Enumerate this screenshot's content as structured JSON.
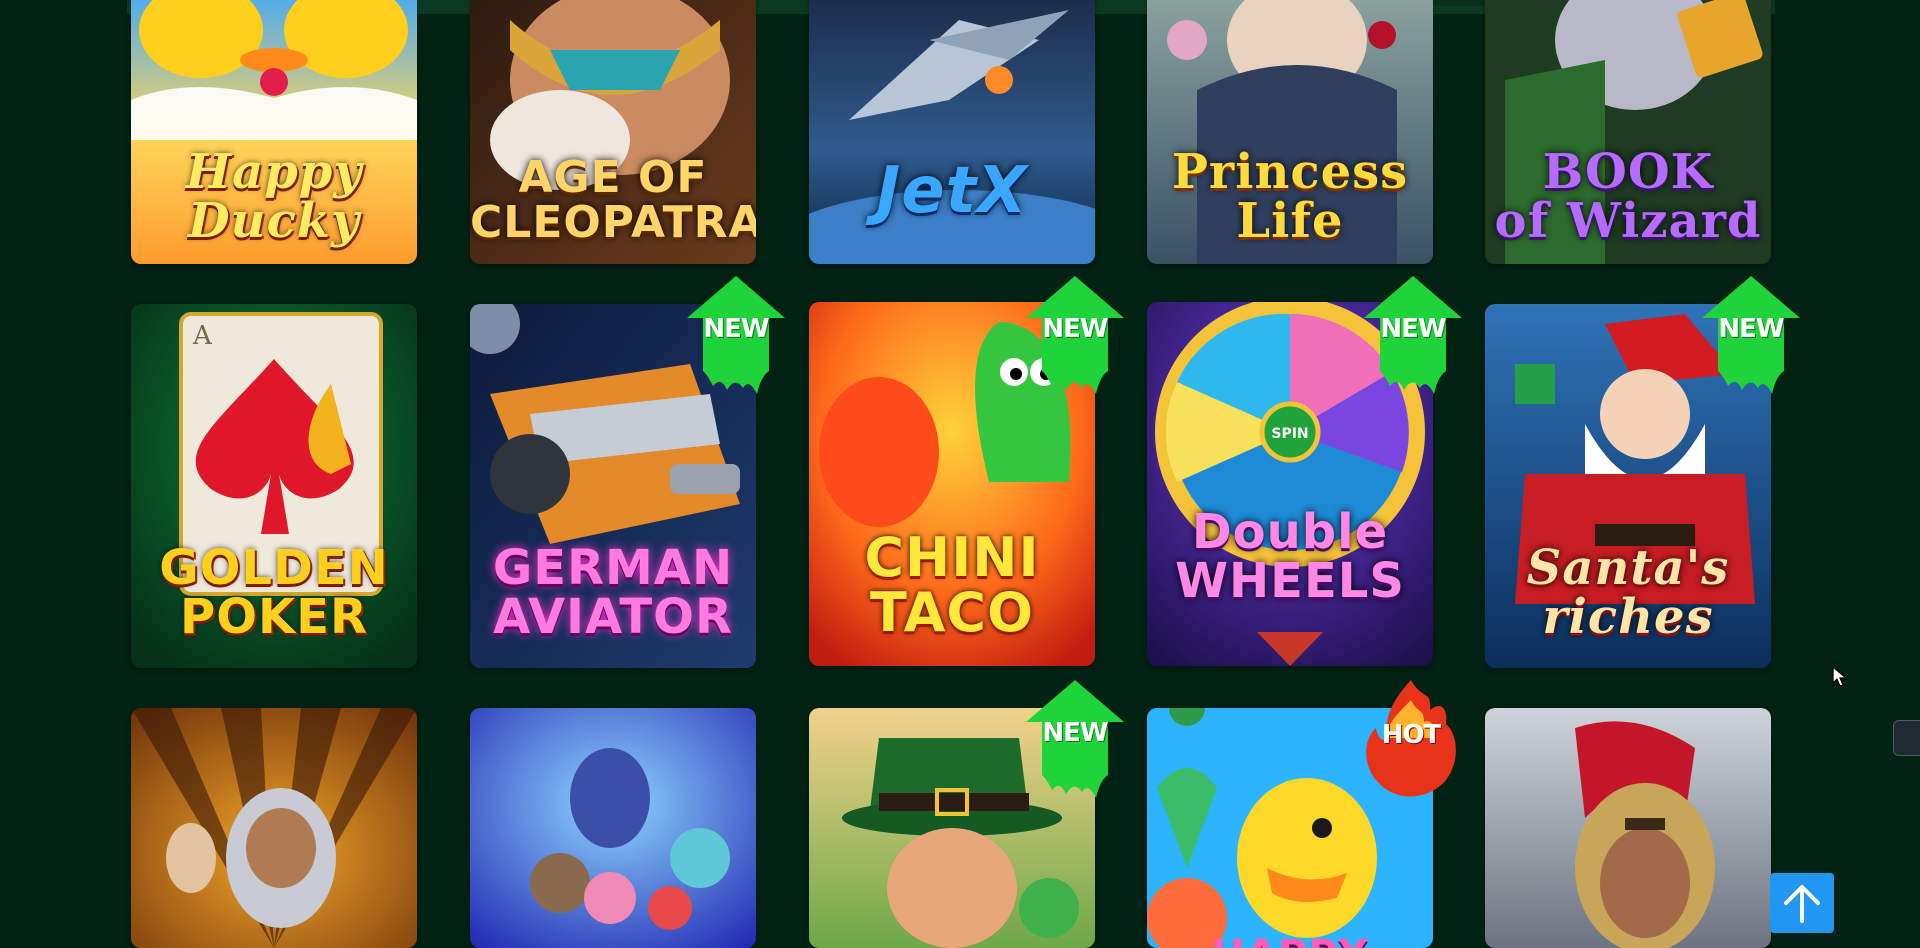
{
  "games": [
    {
      "title": "Happy\nDucky",
      "badge": ""
    },
    {
      "title": "AGE OF\nCLEOPATRA",
      "badge": ""
    },
    {
      "title": "JetX",
      "badge": ""
    },
    {
      "title": "Princess\nLife",
      "badge": ""
    },
    {
      "title": "BOOK\nof Wizard",
      "badge": ""
    },
    {
      "title": "GOLDEN\nPOKER",
      "badge": ""
    },
    {
      "title": "GERMAN\nAVIATOR",
      "badge": "NEW"
    },
    {
      "title": "CHINI\nTACO",
      "badge": "NEW"
    },
    {
      "title": "Double\nWHEELS",
      "badge": "NEW"
    },
    {
      "title": "Santa's\nriches",
      "badge": "NEW"
    },
    {
      "title": "",
      "badge": ""
    },
    {
      "title": "",
      "badge": ""
    },
    {
      "title": "",
      "badge": "NEW"
    },
    {
      "title": "HAPPY",
      "badge": "HOT"
    },
    {
      "title": "",
      "badge": ""
    }
  ],
  "scroll_top": {
    "icon": "arrow-up-icon"
  },
  "colors": {
    "page_bg": "#022213",
    "new_badge": "#1fd43a",
    "hot_badge": "#e8331b",
    "scroll_button": "#2196f3"
  }
}
